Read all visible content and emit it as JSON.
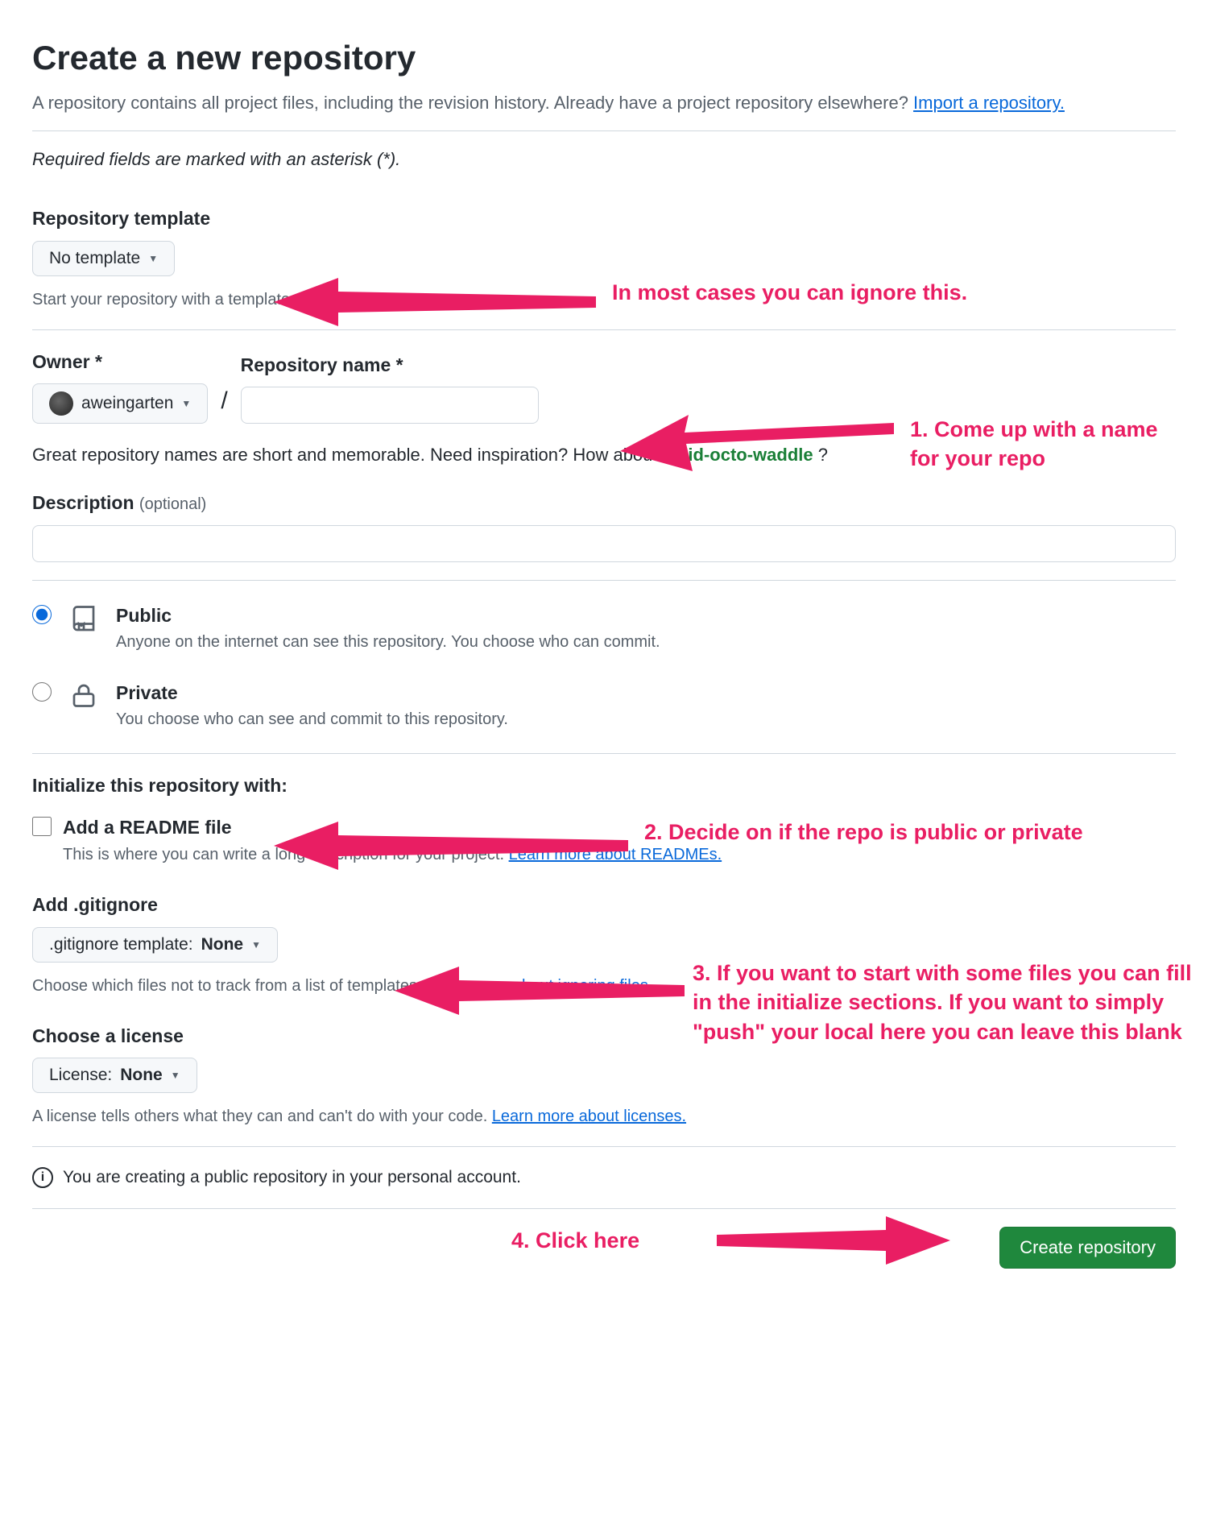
{
  "header": {
    "title": "Create a new repository",
    "subtitle_pre": "A repository contains all project files, including the revision history. Already have a project repository elsewhere? ",
    "subtitle_link": "Import a repository."
  },
  "required_note": "Required fields are marked with an asterisk (*).",
  "template": {
    "label": "Repository template",
    "button": "No template",
    "hint": "Start your repository with a template repository's contents."
  },
  "owner": {
    "label": "Owner *",
    "username": "aweingarten"
  },
  "repo": {
    "label": "Repository name *",
    "value": ""
  },
  "inspiration": {
    "text_pre": "Great repository names are short and memorable. Need inspiration? How about ",
    "suggestion": "solid-octo-waddle",
    "text_post": " ?"
  },
  "description": {
    "label": "Description ",
    "optional": "(optional)",
    "value": ""
  },
  "visibility": {
    "public": {
      "title": "Public",
      "sub": "Anyone on the internet can see this repository. You choose who can commit."
    },
    "private": {
      "title": "Private",
      "sub": "You choose who can see and commit to this repository."
    },
    "selected": "public"
  },
  "initialize": {
    "heading": "Initialize this repository with:",
    "readme": {
      "title": "Add a README file",
      "sub_pre": "This is where you can write a long description for your project. ",
      "sub_link": "Learn more about READMEs."
    },
    "gitignore": {
      "label": "Add .gitignore",
      "button_pre": ".gitignore template: ",
      "button_val": "None",
      "hint_pre": "Choose which files not to track from a list of templates. ",
      "hint_link": "Learn more about ignoring files."
    },
    "license": {
      "label": "Choose a license",
      "button_pre": "License: ",
      "button_val": "None",
      "hint_pre": "A license tells others what they can and can't do with your code. ",
      "hint_link": "Learn more about licenses."
    }
  },
  "info_notice": "You are creating a public repository in your personal account.",
  "submit": "Create repository",
  "annotations": {
    "a1": "In most cases you can ignore this.",
    "a2": "1. Come up with a name for your repo",
    "a3": "2. Decide on if the repo is public or private",
    "a4": "3. If you want to start with some files you can fill in the initialize sections. If you want to simply \"push\" your local here you can leave this blank",
    "a5": "4. Click here"
  }
}
